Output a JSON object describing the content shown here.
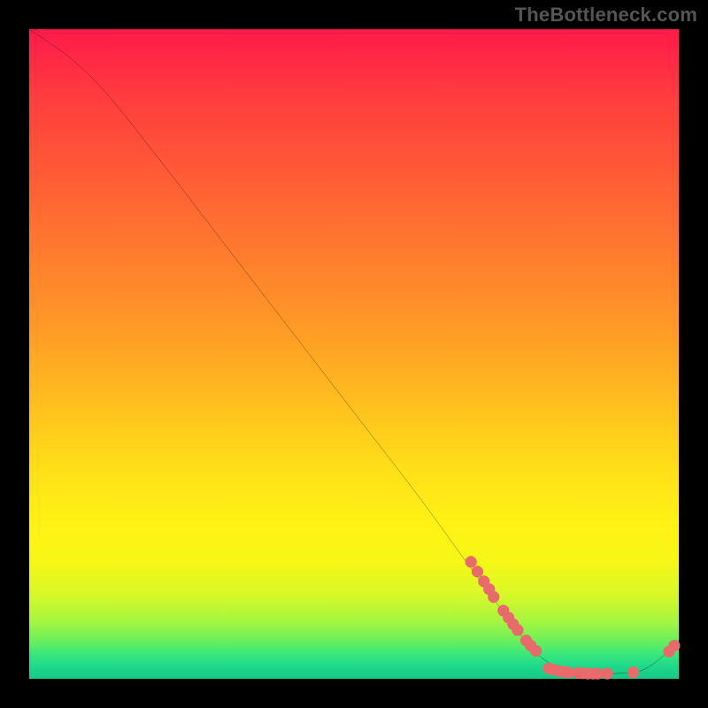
{
  "watermark": "TheBottleneck.com",
  "chart_data": {
    "type": "line",
    "title": "",
    "xlabel": "",
    "ylabel": "",
    "xlim": [
      0,
      100
    ],
    "ylim": [
      0,
      100
    ],
    "curve": [
      {
        "x": 0,
        "y": 100
      },
      {
        "x": 3,
        "y": 98
      },
      {
        "x": 7,
        "y": 95
      },
      {
        "x": 12,
        "y": 90
      },
      {
        "x": 20,
        "y": 80
      },
      {
        "x": 30,
        "y": 67
      },
      {
        "x": 40,
        "y": 54
      },
      {
        "x": 50,
        "y": 41
      },
      {
        "x": 60,
        "y": 28
      },
      {
        "x": 68,
        "y": 17
      },
      {
        "x": 74,
        "y": 9
      },
      {
        "x": 78,
        "y": 4
      },
      {
        "x": 82,
        "y": 1.5
      },
      {
        "x": 86,
        "y": 0.8
      },
      {
        "x": 90,
        "y": 0.8
      },
      {
        "x": 94,
        "y": 1.2
      },
      {
        "x": 97,
        "y": 3
      },
      {
        "x": 100,
        "y": 6
      }
    ],
    "points": [
      {
        "x": 68,
        "y": 18
      },
      {
        "x": 69,
        "y": 16.5
      },
      {
        "x": 70,
        "y": 15
      },
      {
        "x": 70.8,
        "y": 13.8
      },
      {
        "x": 71.5,
        "y": 12.6
      },
      {
        "x": 73,
        "y": 10.5
      },
      {
        "x": 73.8,
        "y": 9.4
      },
      {
        "x": 74.5,
        "y": 8.4
      },
      {
        "x": 75.2,
        "y": 7.5
      },
      {
        "x": 76.5,
        "y": 5.9
      },
      {
        "x": 77.2,
        "y": 5.1
      },
      {
        "x": 78,
        "y": 4.3
      },
      {
        "x": 80,
        "y": 1.6
      },
      {
        "x": 80.8,
        "y": 1.4
      },
      {
        "x": 81.5,
        "y": 1.2
      },
      {
        "x": 82.2,
        "y": 1.1
      },
      {
        "x": 83,
        "y": 1.0
      },
      {
        "x": 84.5,
        "y": 0.9
      },
      {
        "x": 85.2,
        "y": 0.85
      },
      {
        "x": 86,
        "y": 0.8
      },
      {
        "x": 86.8,
        "y": 0.8
      },
      {
        "x": 87.5,
        "y": 0.8
      },
      {
        "x": 89,
        "y": 0.8
      },
      {
        "x": 93,
        "y": 1.0
      },
      {
        "x": 98.5,
        "y": 4.2
      },
      {
        "x": 99.3,
        "y": 5.1
      }
    ],
    "point_color": "#e86a6a",
    "curve_color": "#000000",
    "gradient_stops": [
      {
        "pos": 0,
        "color": "#ff1a4a"
      },
      {
        "pos": 50,
        "color": "#ffc01e"
      },
      {
        "pos": 80,
        "color": "#f6f716"
      },
      {
        "pos": 100,
        "color": "#15c987"
      }
    ]
  }
}
